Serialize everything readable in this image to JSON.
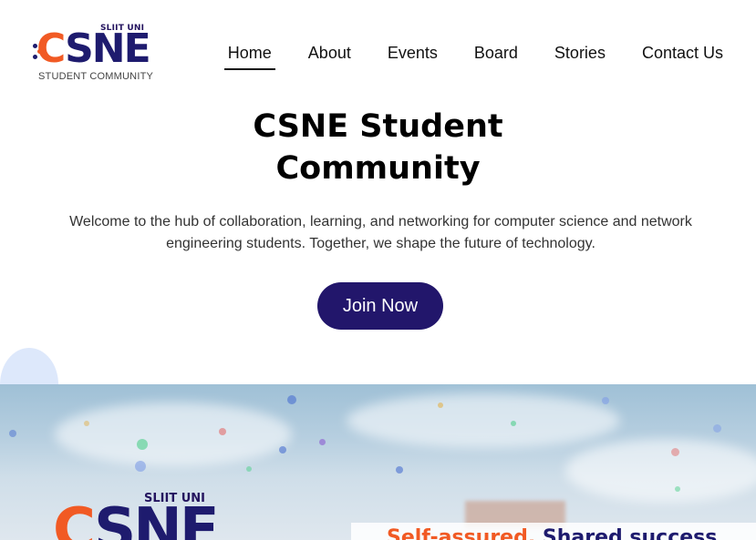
{
  "logo": {
    "top_text": "SLIIT UNI",
    "letter_c": "C",
    "letters": "SNE",
    "subtitle": "STUDENT COMMUNITY"
  },
  "nav": {
    "items": [
      {
        "label": "Home",
        "active": true
      },
      {
        "label": "About"
      },
      {
        "label": "Events"
      },
      {
        "label": "Board"
      },
      {
        "label": "Stories"
      },
      {
        "label": "Contact Us"
      }
    ]
  },
  "hero": {
    "title_line1": "CSNE Student",
    "title_line2": "Community",
    "subtitle": "Welcome to the hub of collaboration, learning, and networking for computer science and network engineering students. Together, we shape the future of technology.",
    "button": "Join Now"
  },
  "banner": {
    "logo_top": "SLIIT UNI",
    "logo_c": "C",
    "logo_letters": "SNE",
    "slogan_part1": "Self-assured,",
    "slogan_part2": "Shared success"
  },
  "colors": {
    "brand_navy": "#22166b",
    "brand_orange": "#f15a24"
  }
}
